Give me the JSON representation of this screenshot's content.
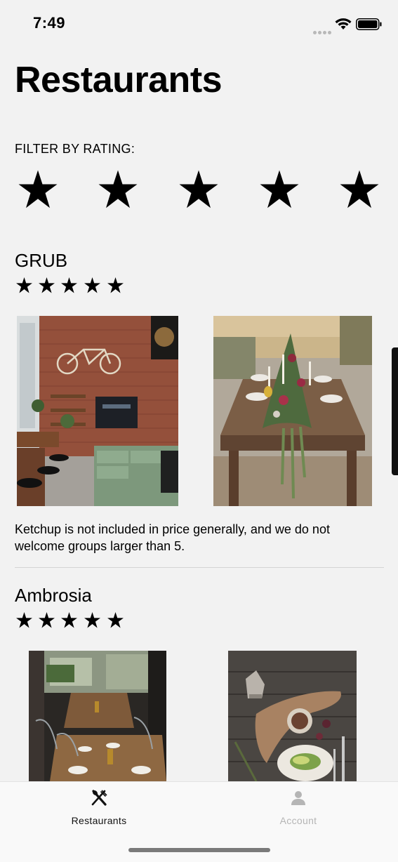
{
  "status_bar": {
    "time": "7:49"
  },
  "page_title": "Restaurants",
  "filter": {
    "label": "FILTER BY RATING:",
    "max_stars": 5
  },
  "restaurants": [
    {
      "name": "GRUB",
      "rating": 5,
      "description": "Ketchup is not included in price generally, and we do not welcome groups larger than 5."
    },
    {
      "name": "Ambrosia",
      "rating": 5
    }
  ],
  "tab_bar": {
    "active_color": "#111111",
    "inactive_color": "#b5b5b5",
    "tabs": [
      {
        "label": "Restaurants",
        "icon": "fork-knife-icon",
        "active": true
      },
      {
        "label": "Account",
        "icon": "person-icon",
        "active": false
      }
    ]
  }
}
